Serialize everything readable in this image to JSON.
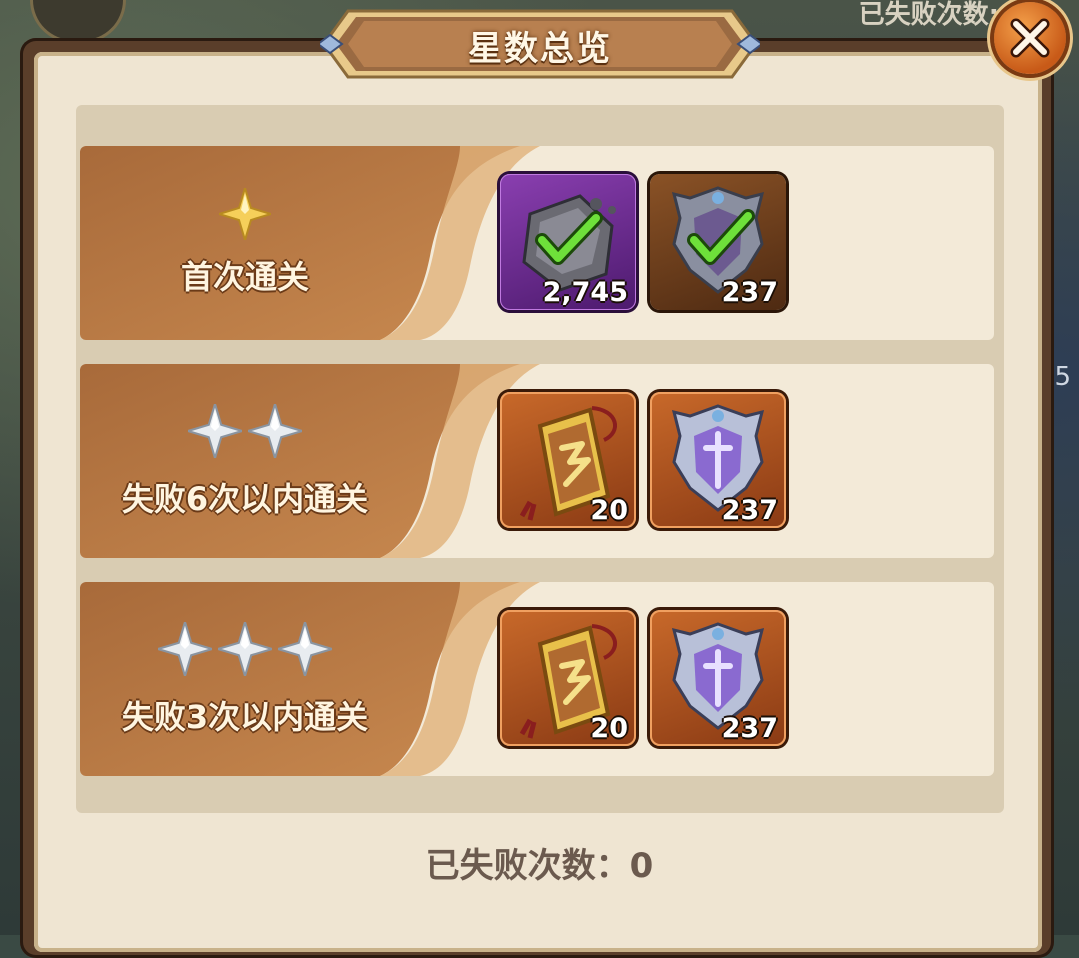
{
  "background": {
    "top_right_text": "已失败次数:",
    "right_edge_text": "5"
  },
  "dialog": {
    "title": "星数总览",
    "close_icon": "close-x-icon"
  },
  "tiers": [
    {
      "stars": 1,
      "star_style": "gold",
      "label": "首次通关",
      "rewards": [
        {
          "icon": "gray-rock-checked-icon",
          "frame": "purple",
          "quantity": "2,745",
          "claimed": true
        },
        {
          "icon": "shield-emblem-checked-icon",
          "frame": "brown",
          "quantity": "237",
          "claimed": true
        }
      ]
    },
    {
      "stars": 2,
      "star_style": "silver",
      "label": "失败6次以内通关",
      "rewards": [
        {
          "icon": "gold-scroll-token-icon",
          "frame": "orange",
          "quantity": "20",
          "claimed": false
        },
        {
          "icon": "purple-shield-emblem-icon",
          "frame": "orange",
          "quantity": "237",
          "claimed": false
        }
      ]
    },
    {
      "stars": 3,
      "star_style": "silver",
      "label": "失败3次以内通关",
      "rewards": [
        {
          "icon": "gold-scroll-token-icon",
          "frame": "orange",
          "quantity": "20",
          "claimed": false
        },
        {
          "icon": "purple-shield-emblem-icon",
          "frame": "orange",
          "quantity": "237",
          "claimed": false
        }
      ]
    }
  ],
  "footer": {
    "fail_count_text": "已失败次数：0"
  }
}
